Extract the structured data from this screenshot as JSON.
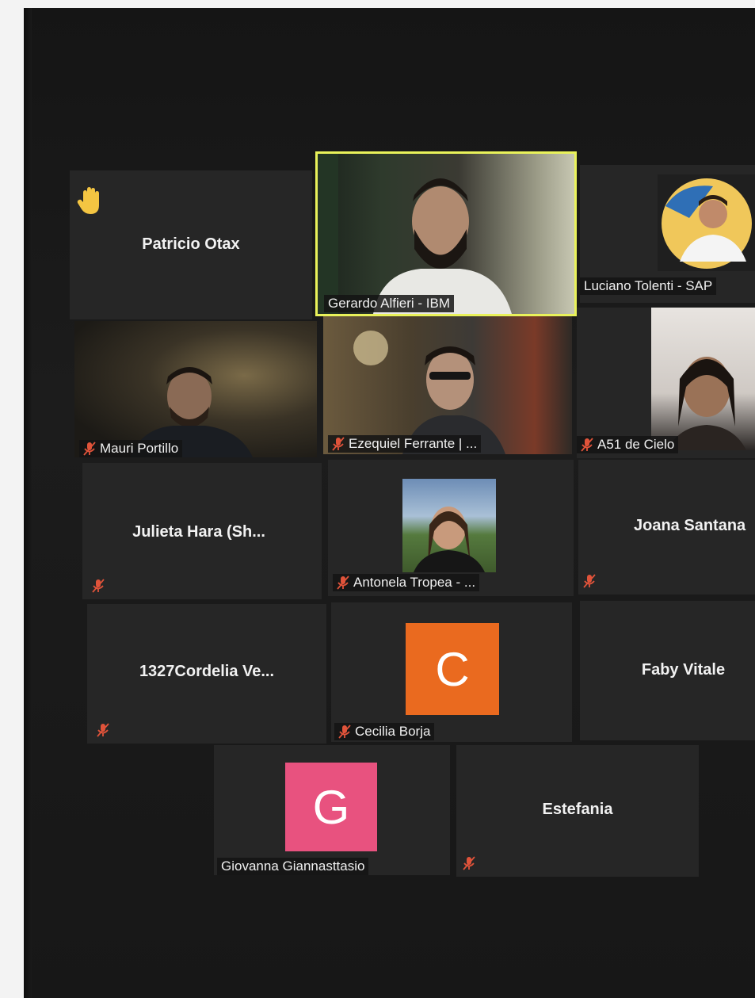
{
  "participants": {
    "patricio": {
      "name": "Patricio Otax"
    },
    "gerardo": {
      "name": "Gerardo Alfieri - IBM"
    },
    "luciano": {
      "name": "Luciano Tolenti - SAP"
    },
    "mauri": {
      "name": "Mauri Portillo"
    },
    "ezequiel": {
      "name": "Ezequiel Ferrante | ..."
    },
    "a51": {
      "name": "A51 de Cielo"
    },
    "julieta": {
      "name": "Julieta Hara (Sh..."
    },
    "antonela": {
      "name": "Antonela Tropea - ..."
    },
    "joana": {
      "name": "Joana Santana"
    },
    "cordelia": {
      "name": "1327Cordelia Ve..."
    },
    "cecilia": {
      "name": "Cecilia Borja",
      "initial": "C"
    },
    "faby": {
      "name": "Faby Vitale"
    },
    "giovanna": {
      "name": "Giovanna Giannasttasio",
      "initial": "G"
    },
    "estefania": {
      "name": "Estefania"
    }
  },
  "colors": {
    "speaker_border": "#e9f25a",
    "mute_icon": "#e0533a",
    "raise_hand": "#f4c542",
    "avatar_c": "#ea6a1f",
    "avatar_g": "#e8527f"
  }
}
